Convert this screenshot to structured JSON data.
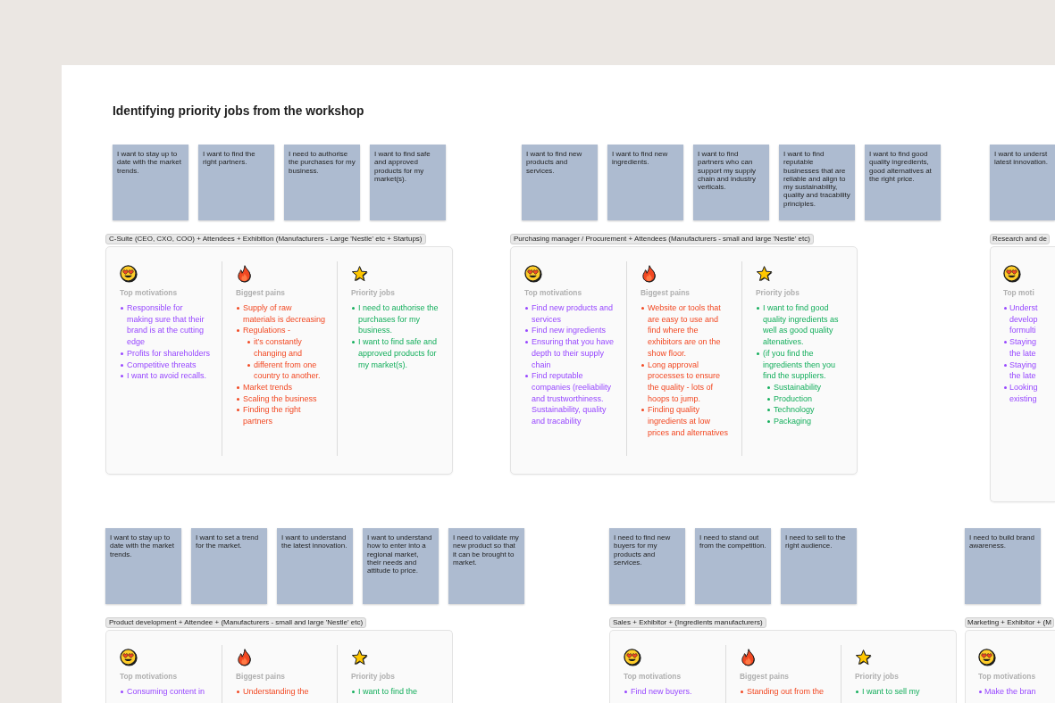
{
  "board": {
    "title": "Identifying priority jobs from the workshop"
  },
  "groups": [
    {
      "notes": [
        {
          "text": "I want to stay up to date with the market trends."
        },
        {
          "text": "I want to find the right partners."
        },
        {
          "text": "I need to authorise the purchases for my business."
        },
        {
          "text": "I want to find safe and approved products for my market(s)."
        }
      ],
      "label": "C-Suite (CEO, CXO, COO) + Attendees + Exhibition (Manufacturers - Large 'Nestle' etc + Startups)",
      "card": {
        "columns": [
          {
            "kind": "motivations",
            "heading": "Top motivations",
            "items": [
              {
                "text": "Responsible for making sure that their brand is at the cutting edge"
              },
              {
                "text": "Profits for shareholders"
              },
              {
                "text": "Competitive threats"
              },
              {
                "text": "I want to avoid recalls."
              }
            ]
          },
          {
            "kind": "pains",
            "heading": "Biggest pains",
            "items": [
              {
                "text": "Supply of raw materials is decreasing"
              },
              {
                "text": "Regulations -",
                "children": [
                  {
                    "text": "it’s constantly changing and"
                  },
                  {
                    "text": "different from one country to another."
                  }
                ]
              },
              {
                "text": "Market trends"
              },
              {
                "text": "Scaling the business"
              },
              {
                "text": "Finding the right partners"
              }
            ]
          },
          {
            "kind": "jobs",
            "heading": "Priority jobs",
            "items": [
              {
                "text": "I need to authorise the purchases for my business."
              },
              {
                "text": "I want to find safe and approved products for my market(s)."
              }
            ]
          }
        ]
      }
    },
    {
      "notes": [
        {
          "text": "I want to find new products and services."
        },
        {
          "text": "I want to find new ingredients."
        },
        {
          "text": "I want to find partners who can support my supply chain and industry verticals."
        },
        {
          "text": "I want to find reputable businesses that are reliable and align to my sustainability, quality and tracability principles."
        },
        {
          "text": "I want to find good quality ingredients, good alternatives at the right price."
        }
      ],
      "label": "Purchasing manager / Procurement + Attendees (Manufacturers - small and large 'Nestle' etc)",
      "card": {
        "columns": [
          {
            "kind": "motivations",
            "heading": "Top motivations",
            "items": [
              {
                "text": "Find new products and services"
              },
              {
                "text": "Find new ingredients"
              },
              {
                "text": "Ensuring that you have depth to their supply chain"
              },
              {
                "text": "Find reputable companies (reeliability and trustworthiness. Sustainability, quality and tracability"
              }
            ]
          },
          {
            "kind": "pains",
            "heading": "Biggest pains",
            "items": [
              {
                "text": "Website or tools that are easy to use and find where the exhibitors are on the show floor."
              },
              {
                "text": "Long approval processes to ensure the quality - lots of hoops to jump."
              },
              {
                "text": "Finding quality ingredients at low prices and alternatives"
              }
            ]
          },
          {
            "kind": "jobs",
            "heading": "Priority jobs",
            "items": [
              {
                "text": "I want to find good quality ingredients as well as good quality altenatives."
              },
              {
                "text": "(if you find the ingredients then you find the suppliers.",
                "children": [
                  {
                    "text": "Sustainability"
                  },
                  {
                    "text": "Production"
                  },
                  {
                    "text": "Technology"
                  },
                  {
                    "text": "Packaging"
                  }
                ]
              }
            ]
          }
        ]
      }
    },
    {
      "notes": [
        {
          "lines": [
            "I want to underst",
            "latest innovation."
          ]
        }
      ],
      "label": "Research and de",
      "card": {
        "columns": [
          {
            "kind": "motivations",
            "heading": "Top moti",
            "items": [
              {
                "lines": [
                  "Underst",
                  "develop",
                  "formulti"
                ]
              },
              {
                "lines": [
                  "Staying",
                  "the late"
                ]
              },
              {
                "lines": [
                  "Staying",
                  "the late"
                ]
              },
              {
                "lines": [
                  "Looking",
                  "existing"
                ]
              }
            ]
          }
        ]
      }
    },
    {
      "notes": [
        {
          "text": "I want to stay up to date with the market trends."
        },
        {
          "text": "I want to set a trend for the market."
        },
        {
          "text": "I want to understand the latest innovation."
        },
        {
          "text": "I want to understand how to enter into a regional market, their needs and attitude to price."
        },
        {
          "text": "I need to validate my new product so that it can be brought to market."
        }
      ],
      "label": "Product development + Attendee + (Manufacturers - small and large 'Nestle' etc)",
      "card": {
        "columns": [
          {
            "kind": "motivations",
            "heading": "Top motivations",
            "items": [
              {
                "lines": [
                  "Consuming content in"
                ]
              }
            ]
          },
          {
            "kind": "pains",
            "heading": "Biggest pains",
            "items": [
              {
                "lines": [
                  "Understanding the"
                ]
              }
            ]
          },
          {
            "kind": "jobs",
            "heading": "Priority jobs",
            "items": [
              {
                "lines": [
                  "I want to find the"
                ]
              }
            ]
          }
        ]
      }
    },
    {
      "notes": [
        {
          "text": "I need to find new buyers for my products and services."
        },
        {
          "text": "I need to stand out from the competition."
        },
        {
          "text": "I need to sell to the right audience."
        }
      ],
      "label": "Sales + Exhibitor + (Ingredients manufacturers)",
      "card": {
        "columns": [
          {
            "kind": "motivations",
            "heading": "Top motivations",
            "items": [
              {
                "text": "Find new buyers."
              }
            ]
          },
          {
            "kind": "pains",
            "heading": "Biggest pains",
            "items": [
              {
                "lines": [
                  "Standing out from the"
                ]
              }
            ]
          },
          {
            "kind": "jobs",
            "heading": "Priority jobs",
            "items": [
              {
                "lines": [
                  "I want to sell my"
                ]
              }
            ]
          }
        ]
      }
    },
    {
      "notes": [
        {
          "text": "I need to build brand awareness."
        }
      ],
      "label": "Marketing + Exhibitor + (M",
      "card": {
        "columns": [
          {
            "kind": "motivations",
            "heading": "Top motivations",
            "items": [
              {
                "lines": [
                  "Make the bran"
                ]
              }
            ]
          }
        ]
      }
    }
  ]
}
